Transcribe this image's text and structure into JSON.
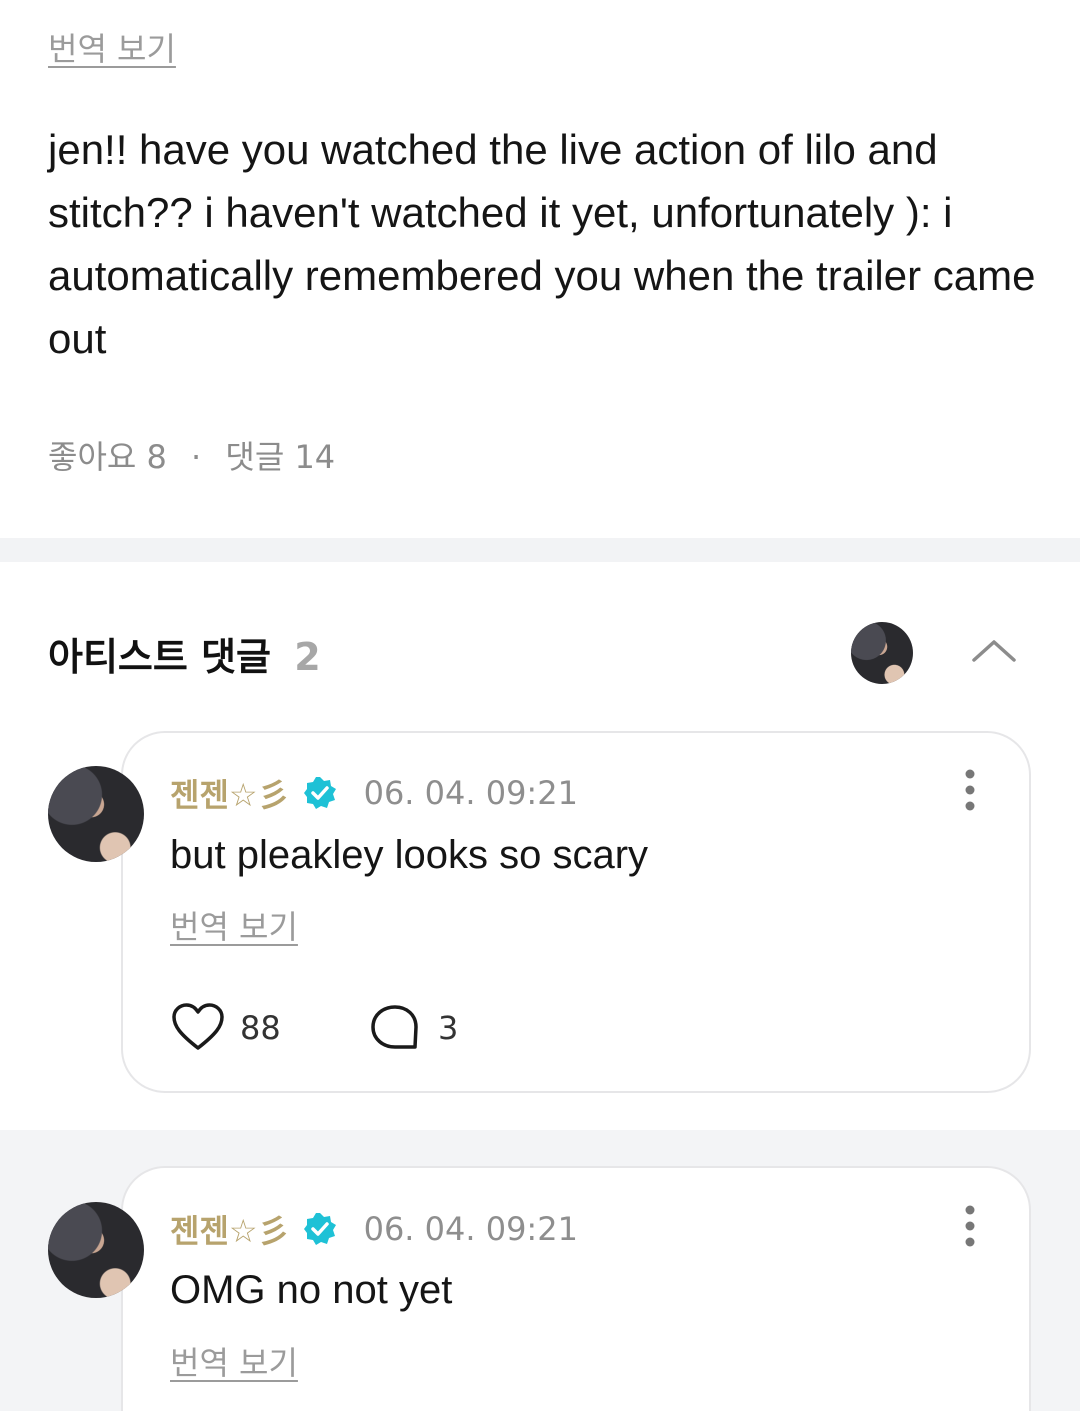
{
  "post": {
    "translate_label": "번역 보기",
    "body": "jen!! have you watched the live action of lilo and stitch?? i haven't watched it yet, unfortunately ): i automatically remembered you when the trailer came out",
    "likes_label": "좋아요",
    "likes_count": "8",
    "separator": "·",
    "comments_label": "댓글",
    "comments_count": "14"
  },
  "artist_comments": {
    "title": "아티스트 댓글",
    "count": "2"
  },
  "comments": [
    {
      "author": "젠젠☆彡",
      "timestamp": "06. 04. 09:21",
      "text": "but pleakley looks so scary",
      "translate_label": "번역 보기",
      "likes": "88",
      "replies": "3"
    },
    {
      "author": "젠젠☆彡",
      "timestamp": "06. 04. 09:21",
      "text": "OMG no not yet",
      "translate_label": "번역 보기"
    }
  ],
  "colors": {
    "author": "#b7a36d",
    "verified_badge": "#1ec1d6",
    "muted_text": "#8e8e8e",
    "divider": "#f2f3f5"
  },
  "icons": [
    "verified-badge-icon",
    "more-options-icon",
    "heart-icon",
    "comment-bubble-icon",
    "chevron-up-icon"
  ]
}
